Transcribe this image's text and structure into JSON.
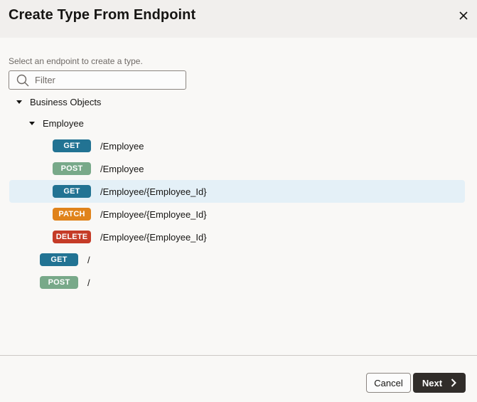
{
  "dialog": {
    "title": "Create Type From Endpoint",
    "close_icon": "close-icon"
  },
  "instructions": "Select an endpoint to create a type.",
  "search": {
    "placeholder": "Filter",
    "value": "",
    "icon": "search-icon"
  },
  "tree": {
    "groups": [
      {
        "label": "Business Objects",
        "expanded": true
      },
      {
        "label": "Employee",
        "expanded": true
      }
    ],
    "endpoints": [
      {
        "method": "GET",
        "path": "/Employee",
        "color": "#227393",
        "selected": false,
        "level": "employee"
      },
      {
        "method": "POST",
        "path": "/Employee",
        "color": "#78a989",
        "selected": false,
        "level": "employee"
      },
      {
        "method": "GET",
        "path": "/Employee/{Employee_Id}",
        "color": "#227393",
        "selected": true,
        "level": "employee"
      },
      {
        "method": "PATCH",
        "path": "/Employee/{Employee_Id}",
        "color": "#e0831b",
        "selected": false,
        "level": "employee"
      },
      {
        "method": "DELETE",
        "path": "/Employee/{Employee_Id}",
        "color": "#c53b27",
        "selected": false,
        "level": "employee"
      },
      {
        "method": "GET",
        "path": "/",
        "color": "#227393",
        "selected": false,
        "level": "business-objects"
      },
      {
        "method": "POST",
        "path": "/",
        "color": "#78a989",
        "selected": false,
        "level": "business-objects"
      }
    ]
  },
  "footer": {
    "cancel_label": "Cancel",
    "next_label": "Next",
    "next_icon": "chevron-right-icon"
  },
  "colors": {
    "selected_row": "#e4f0f7",
    "primary_button": "#312d2a"
  }
}
